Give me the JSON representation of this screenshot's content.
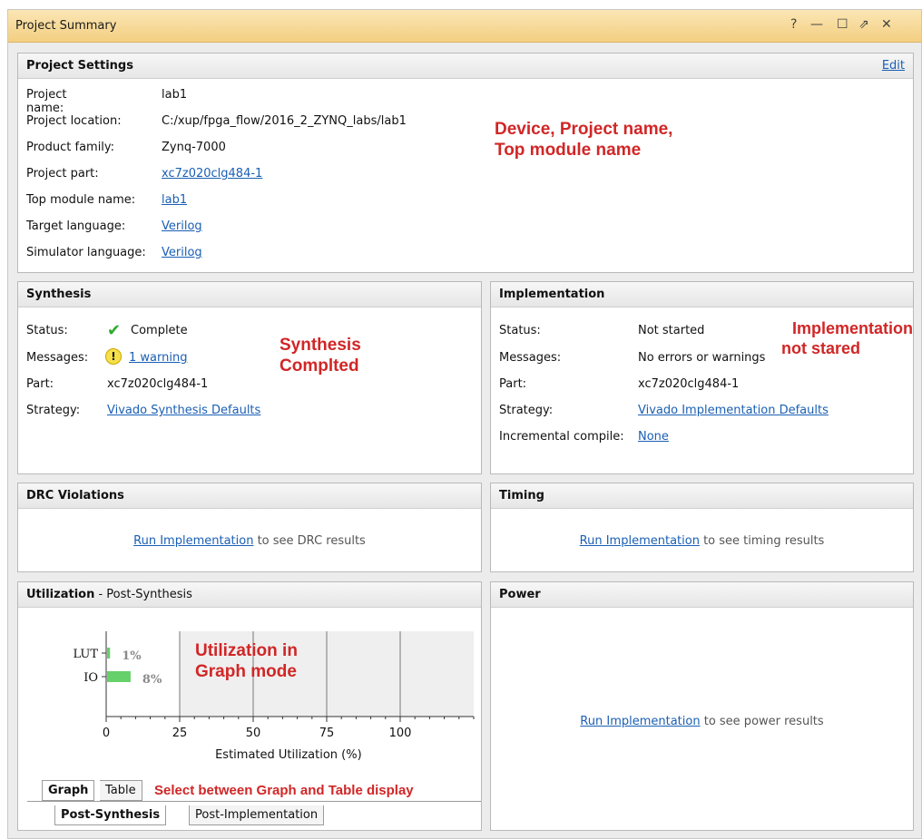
{
  "window": {
    "title": "Project Summary",
    "controls": {
      "help": "?",
      "minimize": "—",
      "maximize": "☐",
      "restore": "⇗",
      "close": "✕"
    }
  },
  "settings": {
    "title": "Project Settings",
    "edit": "Edit",
    "rows": {
      "name": {
        "label": "Project name:",
        "value": "lab1"
      },
      "location": {
        "label": "Project location:",
        "value": "C:/xup/fpga_flow/2016_2_ZYNQ_labs/lab1"
      },
      "family": {
        "label": "Product family:",
        "value": "Zynq-7000"
      },
      "part": {
        "label": "Project part:",
        "value": "xc7z020clg484-1"
      },
      "top": {
        "label": "Top module name:",
        "value": "lab1"
      },
      "target": {
        "label": "Target language:",
        "value": "Verilog"
      },
      "sim": {
        "label": "Simulator language:",
        "value": "Verilog"
      }
    },
    "annotation_line1": "Device, Project name,",
    "annotation_line2": "Top module name"
  },
  "synthesis": {
    "title": "Synthesis",
    "status_label": "Status:",
    "status_value": "Complete",
    "messages_label": "Messages:",
    "messages_value": "1 warning",
    "part_label": "Part:",
    "part_value": "xc7z020clg484-1",
    "strategy_label": "Strategy:",
    "strategy_value": "Vivado Synthesis Defaults",
    "annotation_line1": "Synthesis",
    "annotation_line2": "Complted"
  },
  "implementation": {
    "title": "Implementation",
    "status_label": "Status:",
    "status_value": "Not started",
    "messages_label": "Messages:",
    "messages_value": "No errors or warnings",
    "part_label": "Part:",
    "part_value": "xc7z020clg484-1",
    "strategy_label": "Strategy:",
    "strategy_value": "Vivado Implementation Defaults",
    "incremental_label": "Incremental compile:",
    "incremental_value": "None",
    "annotation_line1": "Implementation",
    "annotation_line2": "not stared"
  },
  "drc": {
    "title": "DRC Violations",
    "link": "Run Implementation",
    "suffix": " to see DRC results"
  },
  "timing": {
    "title": "Timing",
    "link": "Run Implementation",
    "suffix": " to see timing results"
  },
  "utilization": {
    "title": "Utilization",
    "subtitle": " - Post-Synthesis",
    "annotation_line1": "Utilization in",
    "annotation_line2": "Graph mode",
    "view_tabs": [
      "Graph",
      "Table"
    ],
    "view_annotation": "Select between Graph and Table display",
    "stage_tabs": [
      "Post-Synthesis",
      "Post-Implementation"
    ]
  },
  "power": {
    "title": "Power",
    "link": "Run Implementation",
    "suffix": " to see power results"
  },
  "chart_data": {
    "type": "bar",
    "orientation": "horizontal",
    "categories": [
      "LUT",
      "IO"
    ],
    "values": [
      1,
      8
    ],
    "value_labels": [
      "1%",
      "8%"
    ],
    "xlabel": "Estimated Utilization (%)",
    "ylabel": "",
    "xlim": [
      0,
      125
    ],
    "xticks": [
      0,
      25,
      50,
      75,
      100
    ],
    "bar_color": "#66d06a",
    "grid": true
  }
}
